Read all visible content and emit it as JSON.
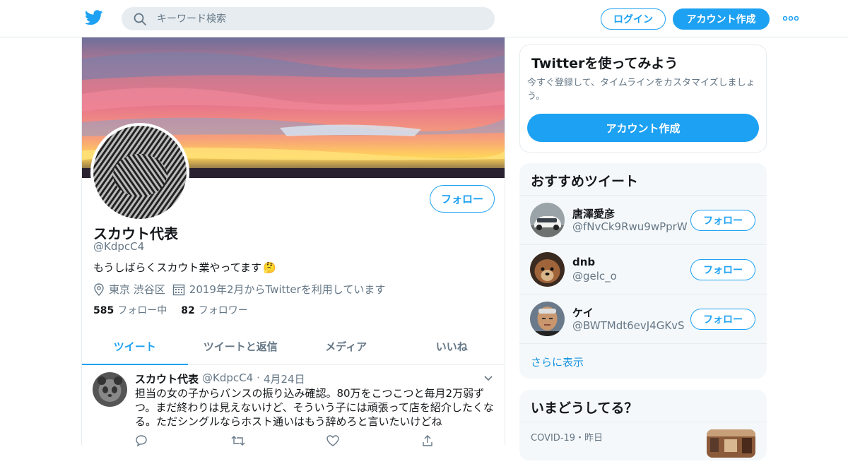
{
  "header": {
    "search_placeholder": "キーワード検索",
    "login_label": "ログイン",
    "signup_label": "アカウント作成"
  },
  "profile": {
    "follow_label": "フォロー",
    "name": "スカウト代表",
    "handle": "@KdpcC4",
    "bio": "もうしばらくスカウト業やってます",
    "bio_emoji": "🤔",
    "location": "東京 渋谷区",
    "joined": "2019年2月からTwitterを利用しています",
    "following_count": "585",
    "following_label": "フォロー中",
    "followers_count": "82",
    "followers_label": "フォロワー"
  },
  "tabs": [
    {
      "label": "ツイート",
      "active": true
    },
    {
      "label": "ツイートと返信",
      "active": false
    },
    {
      "label": "メディア",
      "active": false
    },
    {
      "label": "いいね",
      "active": false
    }
  ],
  "tweet": {
    "name": "スカウト代表",
    "handle": "@KdpcC4",
    "sep": "·",
    "date": "4月24日",
    "text": "担当の女の子からバンスの振り込み確認。80万をこつこつと毎月2万弱ずつ。まだ終わりは見えないけど、そういう子には頑張って店を紹介したくなる。ただシングルならホスト通いはもう辞めろと言いたいけどね"
  },
  "signup_card": {
    "title": "Twitterを使ってみよう",
    "description": "今すぐ登録して、タイムラインをカスタマイズしましょう。",
    "button": "アカウント作成"
  },
  "recommend": {
    "title": "おすすめツイート",
    "follow_label": "フォロー",
    "users": [
      {
        "name": "唐澤愛彦",
        "handle": "@fNvCk9Rwu9wPprW"
      },
      {
        "name": "dnb",
        "handle": "@gelc_o"
      },
      {
        "name": "ケイ",
        "handle": "@BWTMdt6evJ4GKvS"
      }
    ],
    "more": "さらに表示"
  },
  "trends": {
    "title": "いまどうしてる？",
    "category": "COVID-19・昨日"
  },
  "colors": {
    "accent": "#1da1f2",
    "secondary_text": "#657786",
    "panel_bg": "#f5f8fa"
  }
}
